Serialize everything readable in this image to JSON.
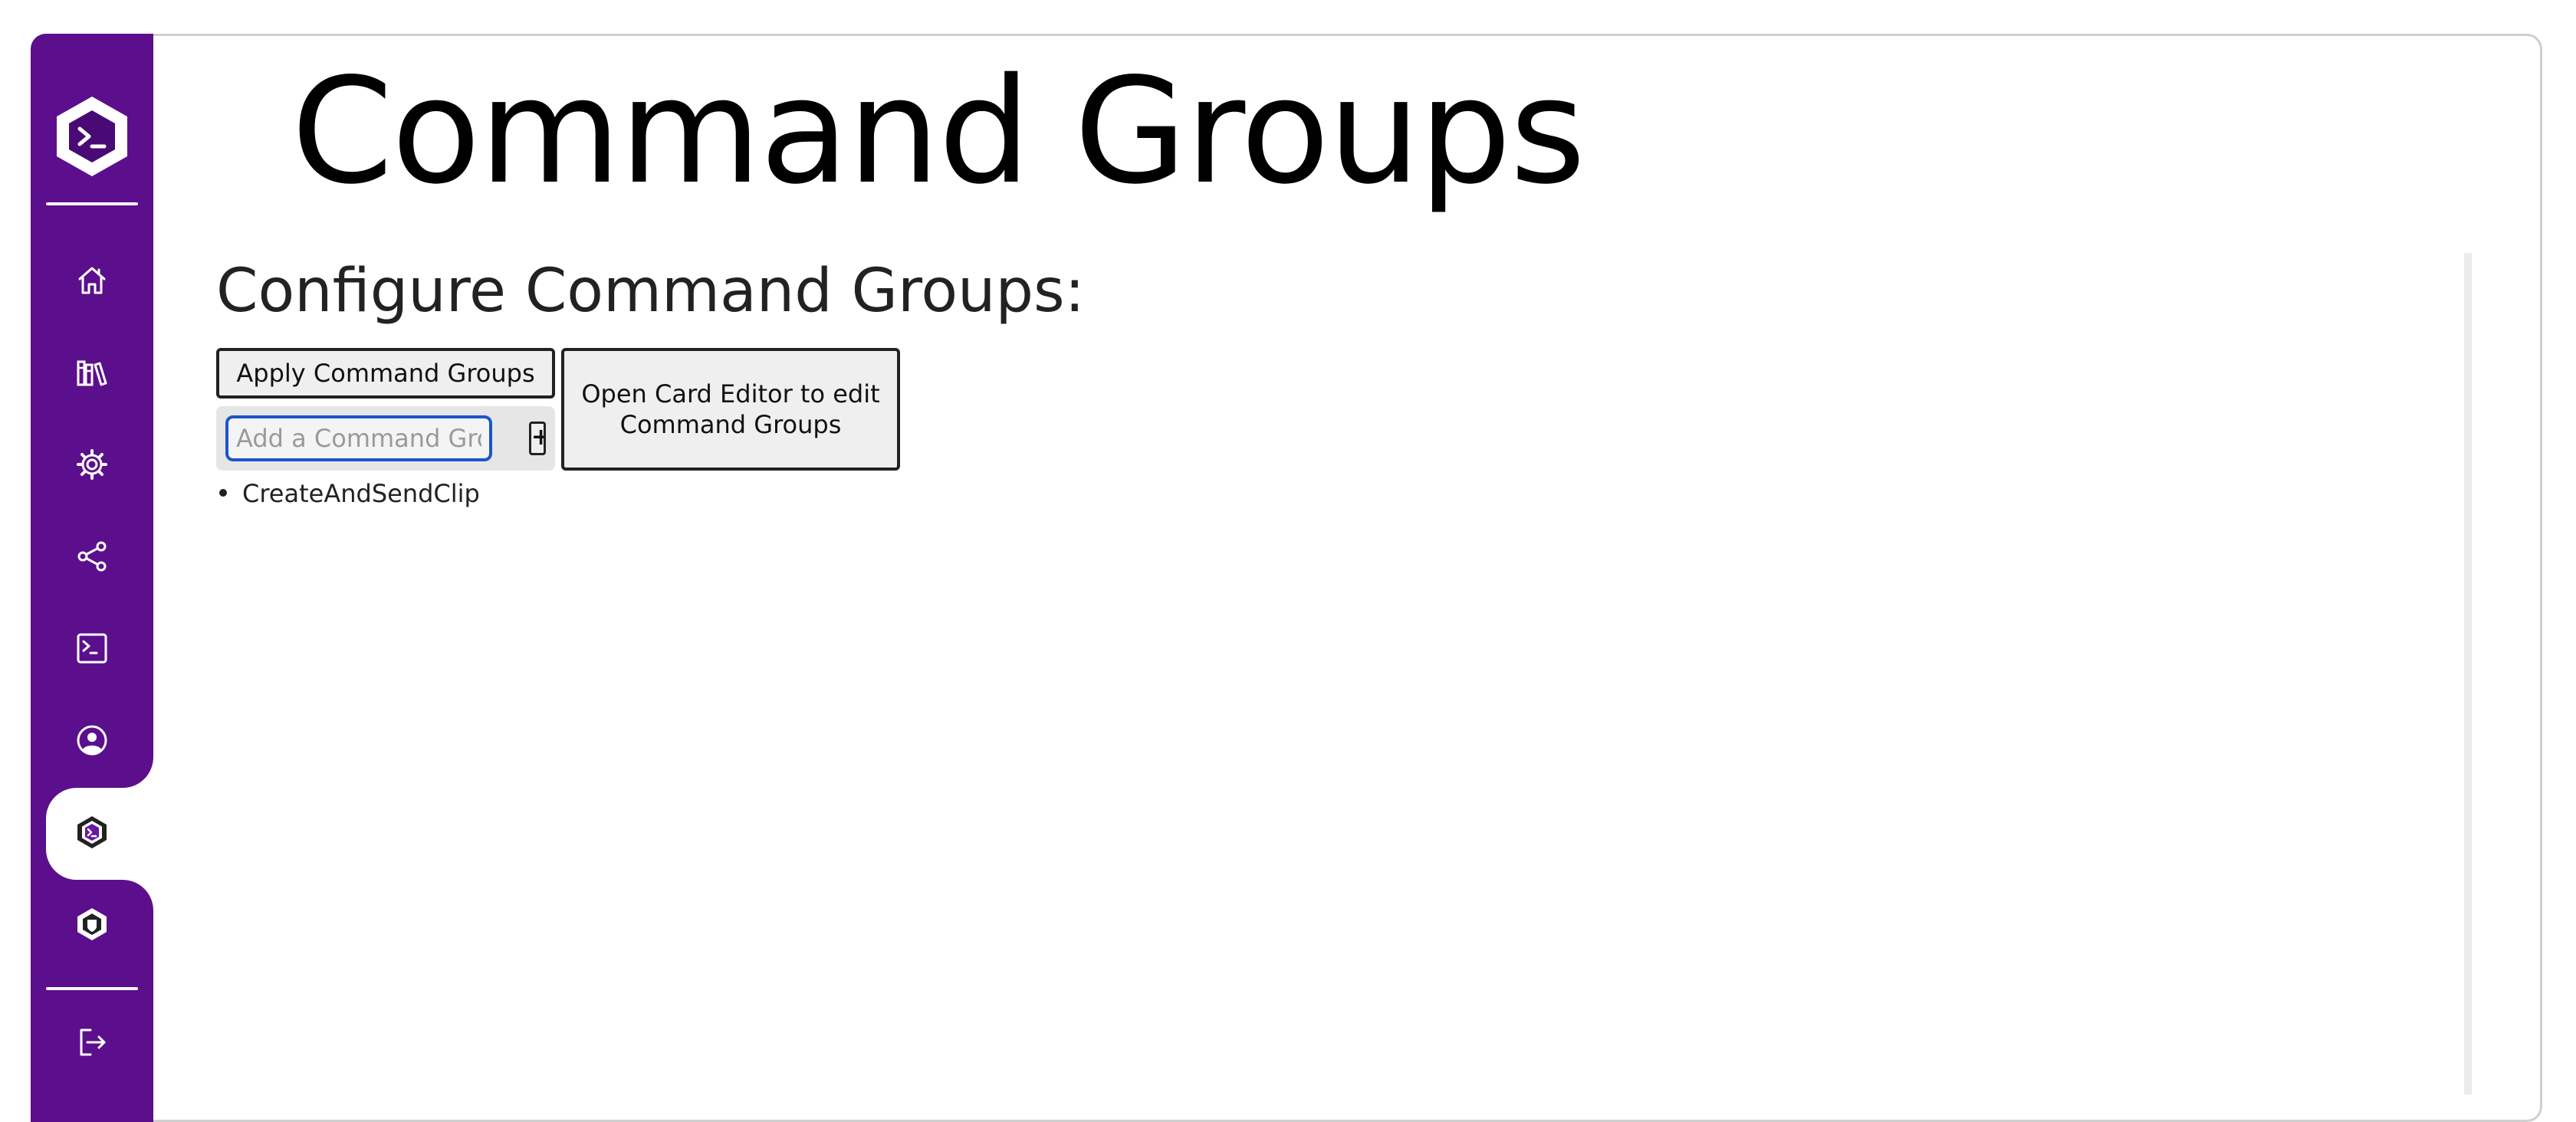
{
  "page": {
    "title": "Command Groups",
    "section_title": "Configure Command Groups:"
  },
  "actions": {
    "apply_label": "Apply Command Groups",
    "open_editor_label": "Open Card Editor to edit Command Groups",
    "add_placeholder": "Add a Command Group",
    "add_label": "+"
  },
  "command_groups": [
    "CreateAndSendClip"
  ],
  "sidebar": {
    "items": [
      {
        "icon": "home-icon"
      },
      {
        "icon": "library-icon"
      },
      {
        "icon": "settings-gear-icon"
      },
      {
        "icon": "share-icon"
      },
      {
        "icon": "terminal-icon"
      },
      {
        "icon": "user-circle-icon"
      },
      {
        "icon": "command-groups-icon",
        "active": true
      },
      {
        "icon": "shield-icon"
      },
      {
        "icon": "logout-icon"
      }
    ]
  },
  "colors": {
    "sidebar": "#5c0f8c",
    "accent_focus": "#1a56c8",
    "button_bg": "#efefef"
  }
}
